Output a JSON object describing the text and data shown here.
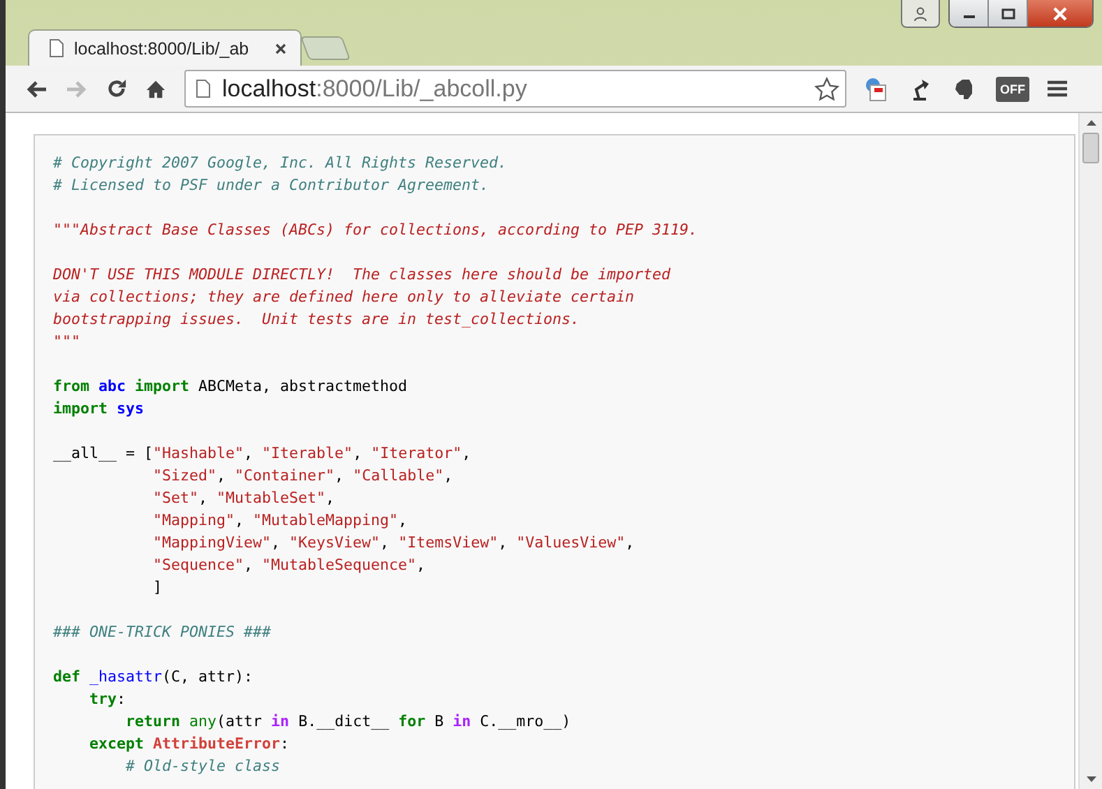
{
  "window": {
    "tab_title": "localhost:8000/Lib/_ab"
  },
  "address_bar": {
    "host": "localhost",
    "rest": ":8000/Lib/_abcoll.py"
  },
  "extension_badge": "OFF",
  "code_lines": [
    {
      "kind": "code",
      "tokens": [
        {
          "text": "# Copyright 2007 Google, Inc. All Rights Reserved.",
          "kind": "comment"
        }
      ]
    },
    {
      "kind": "code",
      "tokens": [
        {
          "text": "# Licensed to PSF under a Contributor Agreement.",
          "kind": "comment"
        }
      ]
    },
    {
      "kind": "blank"
    },
    {
      "kind": "code",
      "tokens": [
        {
          "text": "\"\"\"Abstract Base Classes (ABCs) for collections, according to PEP 3119.",
          "kind": "docstring"
        }
      ]
    },
    {
      "kind": "blank"
    },
    {
      "kind": "code",
      "tokens": [
        {
          "text": "DON'T USE THIS MODULE DIRECTLY!  The classes here should be imported",
          "kind": "docstring"
        }
      ]
    },
    {
      "kind": "code",
      "tokens": [
        {
          "text": "via collections; they are defined here only to alleviate certain",
          "kind": "docstring"
        }
      ]
    },
    {
      "kind": "code",
      "tokens": [
        {
          "text": "bootstrapping issues.  Unit tests are in test_collections.",
          "kind": "docstring"
        }
      ]
    },
    {
      "kind": "code",
      "tokens": [
        {
          "text": "\"\"\"",
          "kind": "docstring"
        }
      ]
    },
    {
      "kind": "blank"
    },
    {
      "kind": "code",
      "tokens": [
        {
          "text": "from",
          "kind": "keyword"
        },
        {
          "text": " abc",
          "kind": "namespace"
        },
        {
          "text": " import",
          "kind": "keyword"
        },
        {
          "text": " ABCMeta, abstractmethod",
          "kind": "plain"
        }
      ]
    },
    {
      "kind": "code",
      "tokens": [
        {
          "text": "import",
          "kind": "keyword"
        },
        {
          "text": " sys",
          "kind": "namespace"
        }
      ]
    },
    {
      "kind": "blank"
    },
    {
      "kind": "code",
      "tokens": [
        {
          "text": "__all__ = [",
          "kind": "plain"
        },
        {
          "text": "\"Hashable\"",
          "kind": "string"
        },
        {
          "text": ", ",
          "kind": "plain"
        },
        {
          "text": "\"Iterable\"",
          "kind": "string"
        },
        {
          "text": ", ",
          "kind": "plain"
        },
        {
          "text": "\"Iterator\"",
          "kind": "string"
        },
        {
          "text": ",",
          "kind": "plain"
        }
      ]
    },
    {
      "kind": "code",
      "tokens": [
        {
          "text": "           \"Sized\"",
          "kind": "string"
        },
        {
          "text": ", ",
          "kind": "plain"
        },
        {
          "text": "\"Container\"",
          "kind": "string"
        },
        {
          "text": ", ",
          "kind": "plain"
        },
        {
          "text": "\"Callable\"",
          "kind": "string"
        },
        {
          "text": ",",
          "kind": "plain"
        }
      ]
    },
    {
      "kind": "code",
      "tokens": [
        {
          "text": "           \"Set\"",
          "kind": "string"
        },
        {
          "text": ", ",
          "kind": "plain"
        },
        {
          "text": "\"MutableSet\"",
          "kind": "string"
        },
        {
          "text": ",",
          "kind": "plain"
        }
      ]
    },
    {
      "kind": "code",
      "tokens": [
        {
          "text": "           \"Mapping\"",
          "kind": "string"
        },
        {
          "text": ", ",
          "kind": "plain"
        },
        {
          "text": "\"MutableMapping\"",
          "kind": "string"
        },
        {
          "text": ",",
          "kind": "plain"
        }
      ]
    },
    {
      "kind": "code",
      "tokens": [
        {
          "text": "           \"MappingView\"",
          "kind": "string"
        },
        {
          "text": ", ",
          "kind": "plain"
        },
        {
          "text": "\"KeysView\"",
          "kind": "string"
        },
        {
          "text": ", ",
          "kind": "plain"
        },
        {
          "text": "\"ItemsView\"",
          "kind": "string"
        },
        {
          "text": ", ",
          "kind": "plain"
        },
        {
          "text": "\"ValuesView\"",
          "kind": "string"
        },
        {
          "text": ",",
          "kind": "plain"
        }
      ]
    },
    {
      "kind": "code",
      "tokens": [
        {
          "text": "           \"Sequence\"",
          "kind": "string"
        },
        {
          "text": ", ",
          "kind": "plain"
        },
        {
          "text": "\"MutableSequence\"",
          "kind": "string"
        },
        {
          "text": ",",
          "kind": "plain"
        }
      ]
    },
    {
      "kind": "code",
      "tokens": [
        {
          "text": "           ]",
          "kind": "plain"
        }
      ]
    },
    {
      "kind": "blank"
    },
    {
      "kind": "code",
      "tokens": [
        {
          "text": "### ONE-TRICK PONIES ###",
          "kind": "comment"
        }
      ]
    },
    {
      "kind": "blank"
    },
    {
      "kind": "code",
      "tokens": [
        {
          "text": "def",
          "kind": "keyword"
        },
        {
          "text": " _hasattr",
          "kind": "function"
        },
        {
          "text": "(C, attr):",
          "kind": "plain"
        }
      ]
    },
    {
      "kind": "code",
      "tokens": [
        {
          "text": "    try",
          "kind": "keyword"
        },
        {
          "text": ":",
          "kind": "plain"
        }
      ]
    },
    {
      "kind": "code",
      "tokens": [
        {
          "text": "        return",
          "kind": "keyword"
        },
        {
          "text": " any",
          "kind": "builtin"
        },
        {
          "text": "(attr ",
          "kind": "plain"
        },
        {
          "text": "in",
          "kind": "operator"
        },
        {
          "text": " B.__dict__ ",
          "kind": "plain"
        },
        {
          "text": "for",
          "kind": "keyword"
        },
        {
          "text": " B ",
          "kind": "plain"
        },
        {
          "text": "in",
          "kind": "operator"
        },
        {
          "text": " C.__mro__)",
          "kind": "plain"
        }
      ]
    },
    {
      "kind": "code",
      "tokens": [
        {
          "text": "    except",
          "kind": "keyword"
        },
        {
          "text": " AttributeError",
          "kind": "exception"
        },
        {
          "text": ":",
          "kind": "plain"
        }
      ]
    },
    {
      "kind": "code",
      "tokens": [
        {
          "text": "        # Old-style class",
          "kind": "comment"
        }
      ]
    }
  ]
}
